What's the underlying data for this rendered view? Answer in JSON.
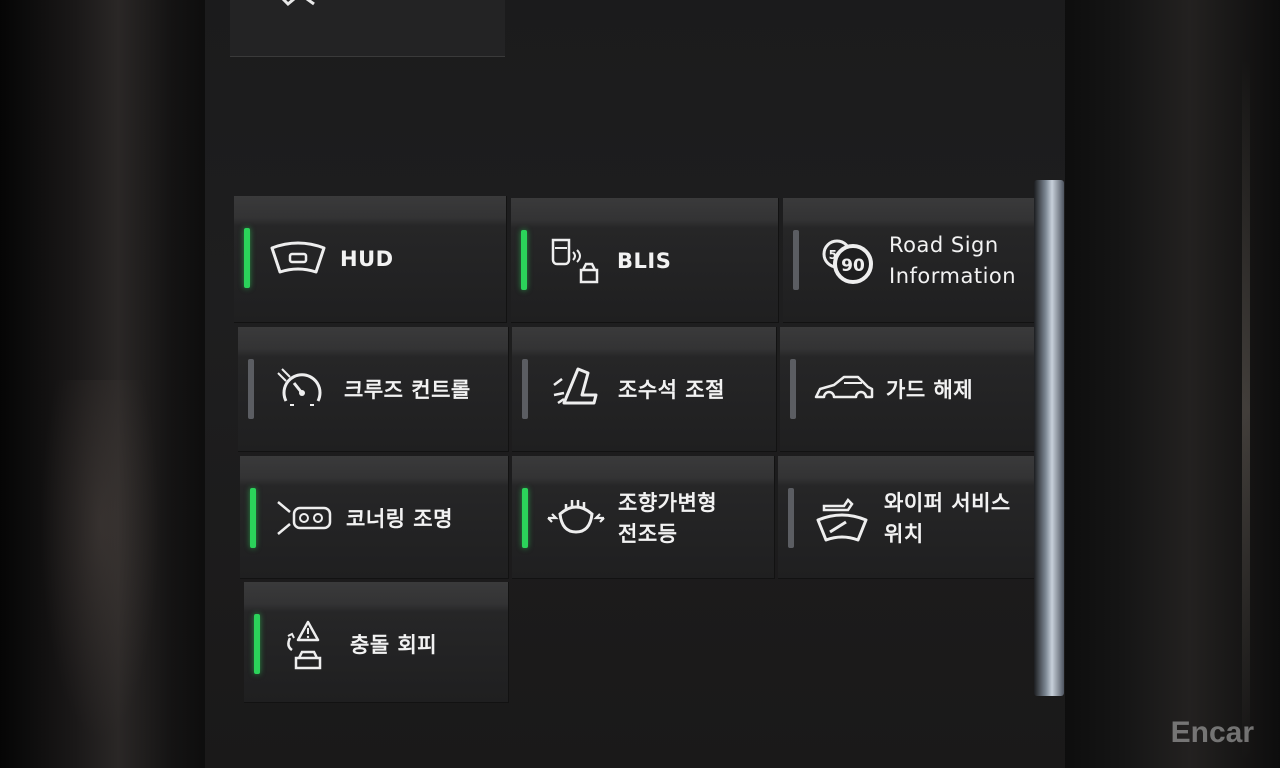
{
  "tiles": [
    {
      "id": "hud",
      "label": "HUD",
      "active": true,
      "icon": "hud-icon"
    },
    {
      "id": "blis",
      "label": "BLIS",
      "active": true,
      "icon": "blis-car-icon"
    },
    {
      "id": "road-sign",
      "label": "Road Sign\nInformation",
      "active": false,
      "icon": "speed-sign-icon",
      "sign_small": "50",
      "sign_big": "90"
    },
    {
      "id": "cruise",
      "label": "크루즈 컨트롤",
      "active": false,
      "icon": "cruise-control-icon"
    },
    {
      "id": "passenger-seat",
      "label": "조수석 조절",
      "active": false,
      "icon": "seat-icon"
    },
    {
      "id": "guard",
      "label": "가드 해제",
      "active": false,
      "icon": "car-side-icon"
    },
    {
      "id": "cornering",
      "label": "코너링 조명",
      "active": true,
      "icon": "cornering-light-icon"
    },
    {
      "id": "headlight",
      "label": "조향가변형\n전조등",
      "active": true,
      "icon": "headlight-icon"
    },
    {
      "id": "wiper",
      "label": "와이퍼 서비스\n위치",
      "active": false,
      "icon": "wiper-icon"
    },
    {
      "id": "collision",
      "label": "충돌 회피",
      "active": true,
      "icon": "collision-warning-icon"
    }
  ],
  "watermark": "Encar",
  "colors": {
    "active_indicator": "#2bd35a",
    "inactive_indicator": "#5b5d62",
    "label": "#f2f2f2"
  }
}
